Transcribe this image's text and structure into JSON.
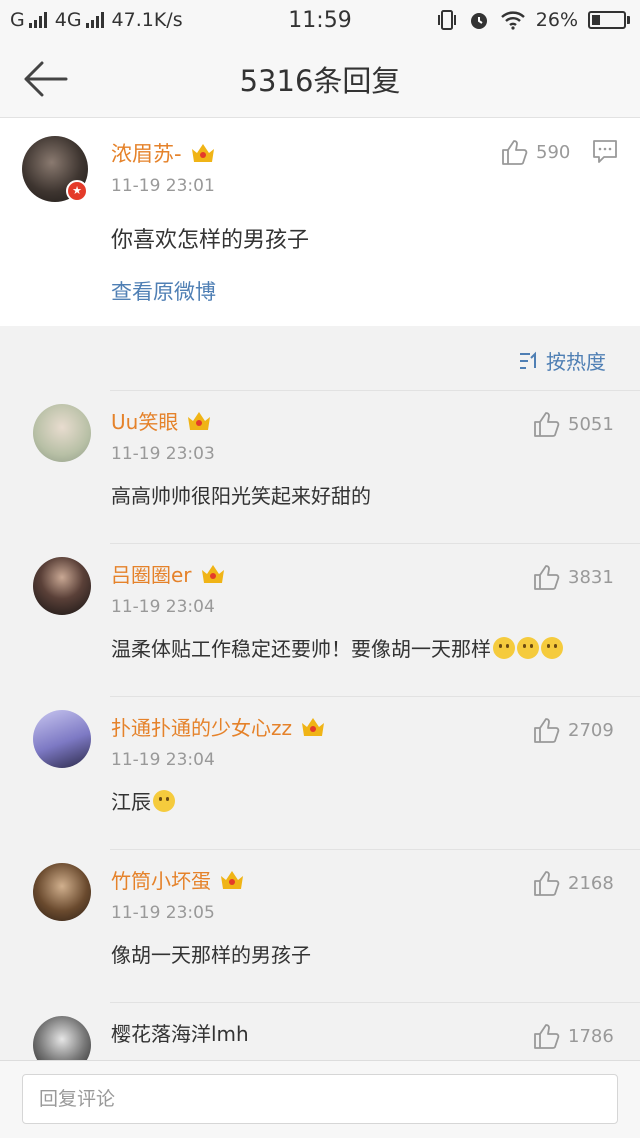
{
  "status_bar": {
    "carrier_left": "G",
    "network": "4G",
    "speed": "47.1K/s",
    "time": "11:59",
    "battery": "26%",
    "battery_level": 0.26,
    "icons": [
      "signal-icon",
      "vibrate-icon",
      "alarm-icon",
      "wifi-icon",
      "battery-icon"
    ]
  },
  "nav": {
    "back_icon": "back-arrow-icon",
    "title": "5316条回复"
  },
  "original_post": {
    "username": "浓眉苏-",
    "time": "11-19 23:01",
    "content": "你喜欢怎样的男孩子",
    "likes": "590",
    "view_original": "查看原微博",
    "icons": [
      "avatar",
      "verified-badge-icon",
      "crown-icon",
      "thumbs-up-icon",
      "comment-icon"
    ]
  },
  "sort": {
    "label": "按热度",
    "icon": "sort-icon"
  },
  "replies": [
    {
      "username": "Uu笑眼",
      "time": "11-19 23:03",
      "content": "高高帅帅很阳光笑起来好甜的",
      "likes": "5051",
      "crown": true
    },
    {
      "username": "吕圈圈er",
      "time": "11-19 23:04",
      "content": "温柔体贴工作稳定还要帅！要像胡一天那样",
      "likes": "3831",
      "crown": true,
      "emoji_count": 3,
      "emoji": "doge-emoji-icon"
    },
    {
      "username": "扑通扑通的少女心zz",
      "time": "11-19 23:04",
      "content": "江辰",
      "likes": "2709",
      "crown": true,
      "emoji_count": 1,
      "emoji": "smile-emoji-icon"
    },
    {
      "username": "竹筒小坏蛋",
      "time": "11-19 23:05",
      "content": "像胡一天那样的男孩子",
      "likes": "2168",
      "crown": true
    },
    {
      "username": "樱花落海洋lmh",
      "time": "",
      "content": "",
      "likes": "1786",
      "crown": false
    }
  ],
  "reply_bar": {
    "placeholder": "回复评论"
  },
  "colors": {
    "username": "#e5822a",
    "link": "#4f7fb4",
    "background": "#f2f2f2",
    "crown": "#f0b416",
    "verified_badge": "#e43b2a"
  }
}
